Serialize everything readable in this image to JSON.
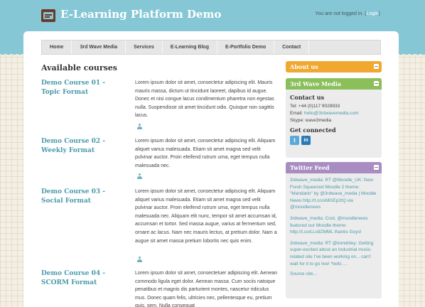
{
  "header": {
    "site_title": "E-Learning Platform Demo",
    "login_prefix": "You are not logged in. (",
    "login_link": "Login",
    "login_suffix": ")"
  },
  "nav": {
    "items": [
      "Home",
      "3rd Wave Media",
      "Services",
      "E-Learning Blog",
      "E-Portfolio Demo",
      "Contact"
    ]
  },
  "main": {
    "heading": "Available courses",
    "courses": [
      {
        "title": "Demo Course 01 - Topic Format",
        "summary": "Lorem ipsum dolor sit amet, consectetur adipiscing elit. Mauris mauris massa, dictum ut tincidunt laoreet, dapibus id augue. Donec et nisi congue lacus condimentum pharetra non egestas nulla. Suspendisse sit amet tincidunt odio. Quisque non sagittis lacus."
      },
      {
        "title": "Demo Course 02 - Weekly Format",
        "summary": "Lorem ipsum dolor sit amet, consectetur adipiscing elit. Aliquam aliquet varius malesuada. Etiam sit amet magna sed velit pulvinar auctor. Proin eleifend rutrum urna, eget tempus nulla malesuada nec."
      },
      {
        "title": "Demo Course 03 - Social Format",
        "summary": "Lorem ipsum dolor sit amet, consectetur adipiscing elit. Aliquam aliquet varius malesuada. Etiam sit amet magna sed velit pulvinar auctor. Proin eleifend rutrum urna, eget tempus nulla malesuada nec. Aliquam elit nunc, tempor sit amet accumsan id, accumsan et tortor. Sed massa augue, varius at fermentum sed, ornare ac lacus. Nam nec mauris lectus, at pretium dolor. Nam a augue sit amet massa pretium lobortis nec quis enim."
      },
      {
        "title": "Demo Course 04 - SCORM Format",
        "summary": "Lorem ipsum dolor sit amet, consectetuer adipiscing elit. Aenean commodo ligula eget dolor. Aenean massa. Cum sociis natoque penatibus et magnis dis parturient montes, nascetur ridiculus mus. Donec quam felis, ultricies nec, pellentesque eu, pretium quis, sem. Nulla consequat"
      }
    ]
  },
  "sidebar": {
    "about": {
      "title": "About us"
    },
    "wave": {
      "title": "3rd Wave Media",
      "contact_heading": "Contact us",
      "tel": "Tel: +44 (0)117 9028933",
      "email_prefix": "Email: ",
      "email": "hello@3rdwavemedia.com",
      "skype": "Skype: wave3media",
      "connected_heading": "Get connected",
      "social": [
        {
          "icon": "twitter-icon",
          "glyph": "t"
        },
        {
          "icon": "linkedin-icon",
          "glyph": "in"
        }
      ]
    },
    "twitter": {
      "title": "Twitter Feed",
      "tweets": [
        "3rdwave_media: RT @Moodle_UK: New Fresh Squeezed Moodle 2 theme: \"Mandarin\" by @3rdwave_media | Moodle News http://t.co/xMGEp2tQ via @moodlenews",
        "3rdwave_media: Cool, @moodlenews featured our Moodle theme: http://t.co/LLs9ZMML thanks Guys!",
        "3rdwave_media: RT @tomdriley: Getting super-excited about an Industrial music-related site I've been working on... can't wait for it to go live! *twitc ..."
      ],
      "source": "Source site..."
    }
  },
  "colors": {
    "header_band": "#86c7d5",
    "about_header": "#f0a830",
    "wave_header": "#8bbf5a",
    "twitter_header": "#a98cc2",
    "twitter_blue": "#5aa9d6",
    "linkedin_blue": "#2a7ab5",
    "link": "#4a9aab"
  }
}
